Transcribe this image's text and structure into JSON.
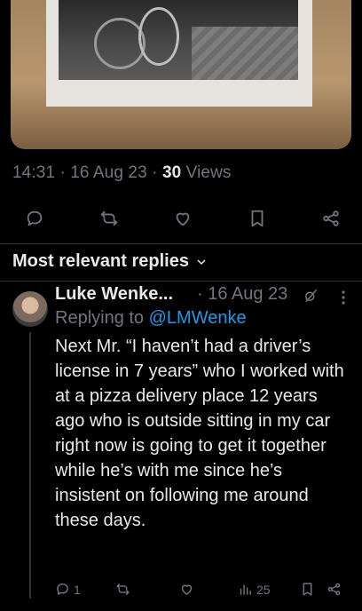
{
  "tweet": {
    "time": "14:31",
    "date": "16 Aug 23",
    "views_count": "30",
    "views_label": "Views"
  },
  "tweet_actions": [
    "reply-icon",
    "retweet-icon",
    "like-icon",
    "bookmark-icon",
    "share-icon"
  ],
  "replies_sort": {
    "label": "Most relevant replies"
  },
  "reply": {
    "author_name": "Luke Wenke...",
    "time": "16 Aug 23",
    "replying_to_prefix": "Replying to",
    "replying_to_handle": "@LMWenke",
    "text": "Next Mr. “I haven’t had a driver’s license in 7 years” who I worked with at a pizza delivery place 12 years ago who is outside sitting in my car right now is going to get it together while he’s with me since he’s insistent on following me around these days.",
    "reply_count": "1",
    "views_count": "25"
  },
  "colors": {
    "background": "#000000",
    "text": "#e7e9ea",
    "muted": "#71767b",
    "link": "#1d9bf0",
    "divider": "#2f3336"
  }
}
